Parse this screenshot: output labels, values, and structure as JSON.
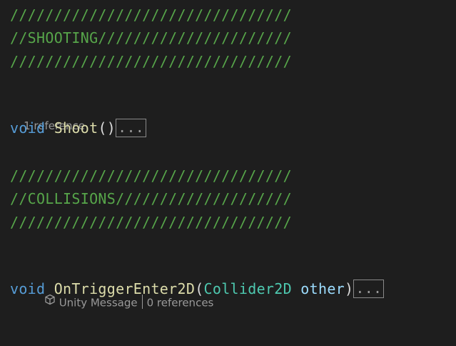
{
  "code": {
    "comment_bar": "////////////////////////////////",
    "shooting_header": "//SHOOTING//////////////////////",
    "collisions_header": "//COLLISIONS////////////////////",
    "shoot": {
      "lens_references": "1 reference",
      "keyword": "void",
      "name": "Shoot",
      "parens": "()",
      "collapsed": "..."
    },
    "on_trigger": {
      "lens_unity": "Unity Message",
      "lens_references": "0 references",
      "keyword": "void",
      "name": "OnTriggerEnter2D",
      "open_paren": "(",
      "param_type": "Collider2D",
      "param_name": "other",
      "close_paren": ")",
      "collapsed": "..."
    }
  },
  "icons": {
    "unity_message": "cube-icon"
  },
  "colors": {
    "background": "#1e1e1e",
    "comment": "#57a64a",
    "keyword": "#569cd6",
    "method": "#dcdcaa",
    "type": "#4ec9b0",
    "parameter": "#9cdcfe",
    "codelens": "#999999"
  }
}
